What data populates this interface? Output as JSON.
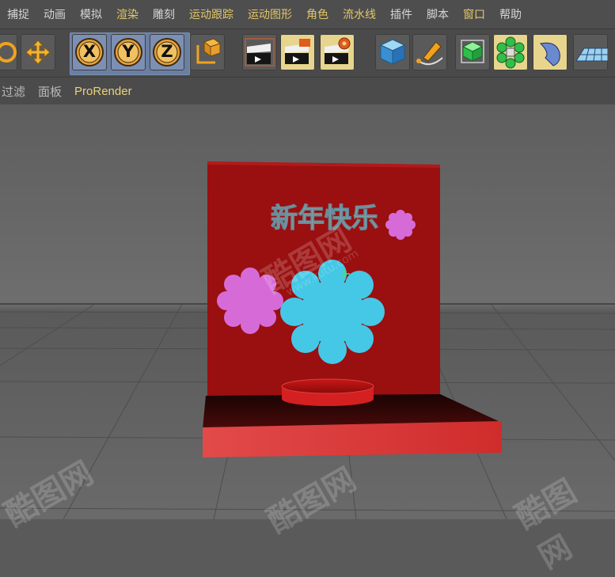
{
  "menu": {
    "items": [
      {
        "label": "捕捉",
        "color": "#d6d6d6"
      },
      {
        "label": "动画",
        "color": "#d6d6d6"
      },
      {
        "label": "模拟",
        "color": "#d6d6d6"
      },
      {
        "label": "渲染",
        "color": "#e3c76a"
      },
      {
        "label": "雕刻",
        "color": "#d6d6d6"
      },
      {
        "label": "运动跟踪",
        "color": "#e3c76a"
      },
      {
        "label": "运动图形",
        "color": "#e3c76a"
      },
      {
        "label": "角色",
        "color": "#e3c76a"
      },
      {
        "label": "流水线",
        "color": "#e3c76a"
      },
      {
        "label": "插件",
        "color": "#d6d6d6"
      },
      {
        "label": "脚本",
        "color": "#d6d6d6"
      },
      {
        "label": "窗口",
        "color": "#e3c76a"
      },
      {
        "label": "帮助",
        "color": "#d6d6d6"
      }
    ]
  },
  "toolbar": {
    "axis_x": "X",
    "axis_y": "Y",
    "axis_z": "Z",
    "icons": [
      "rotate-icon",
      "move-icon",
      "axis-x-icon",
      "axis-y-icon",
      "axis-z-icon",
      "coordinate-system-icon",
      "render-region-icon",
      "render-view-icon",
      "render-settings-icon",
      "cube-icon",
      "pen-icon",
      "subdivision-icon",
      "cloner-icon",
      "deformer-icon",
      "floor-icon"
    ]
  },
  "panel": {
    "items": [
      "过滤",
      "面板",
      "ProRender"
    ]
  },
  "scene": {
    "greeting_text": "新年快乐",
    "board_color": "#9a0f10",
    "base_color": "#d83a3a",
    "flower_cyan": "#45c8e6",
    "flower_pink": "#d66bd8"
  },
  "watermark": {
    "brand": "酷图网",
    "url": "www.kutu.com"
  }
}
